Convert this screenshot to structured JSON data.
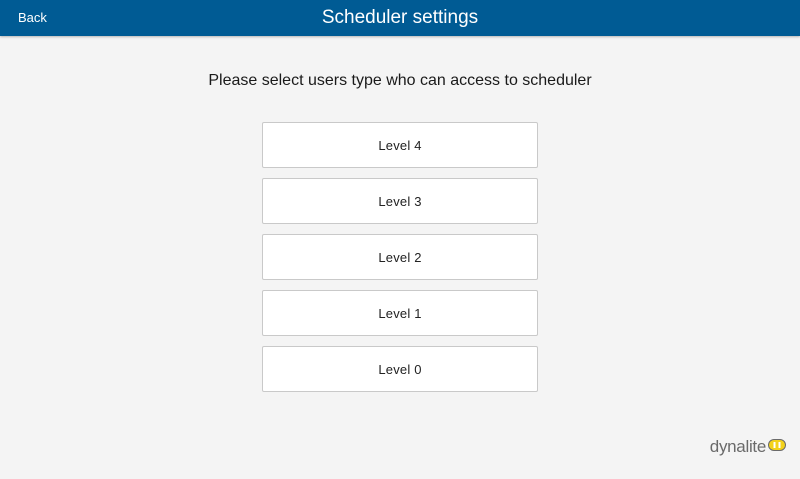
{
  "header": {
    "back_label": "Back",
    "title": "Scheduler settings"
  },
  "main": {
    "prompt": "Please select users type who can access to scheduler",
    "levels": [
      {
        "label": "Level 4"
      },
      {
        "label": "Level 3"
      },
      {
        "label": "Level 2"
      },
      {
        "label": "Level 1"
      },
      {
        "label": "Level 0"
      }
    ]
  },
  "brand": {
    "name": "dynalite"
  },
  "colors": {
    "header_bg": "#005b94",
    "page_bg": "#f4f4f4",
    "logo_yellow": "#f3d21b"
  }
}
